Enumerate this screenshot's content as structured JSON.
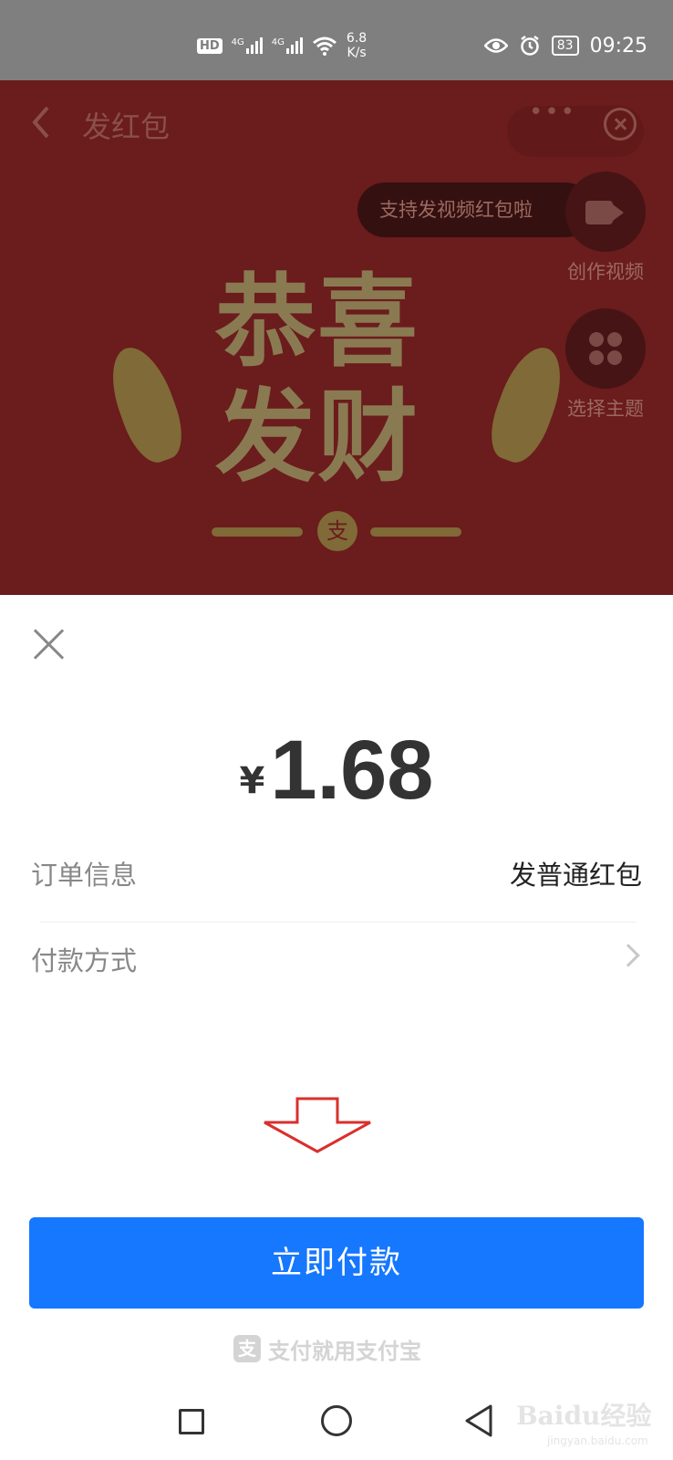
{
  "status_bar": {
    "hd": "HD",
    "net_type_1": "4G",
    "net_type_2": "4G",
    "net_speed_value": "6.8",
    "net_speed_unit": "K/s",
    "battery": "83",
    "time": "09:25"
  },
  "header": {
    "title": "发红包"
  },
  "envelope": {
    "tip": "支持发视频红包啦",
    "create_video_label": "创作视频",
    "choose_theme_label": "选择主题",
    "line1": "恭喜",
    "line2": "发财",
    "seal": "支"
  },
  "payment": {
    "currency": "¥",
    "amount": "1.68",
    "order_label": "订单信息",
    "order_value": "发普通红包",
    "method_label": "付款方式",
    "pay_button": "立即付款",
    "brand_text": "支付就用支付宝",
    "brand_logo": "支"
  },
  "watermark": {
    "main": "Baidu经验",
    "sub": "jingyan.baidu.com"
  },
  "colors": {
    "primary": "#1677ff",
    "envelope_bg": "#6b1c1c",
    "annotation": "#d9302c"
  }
}
